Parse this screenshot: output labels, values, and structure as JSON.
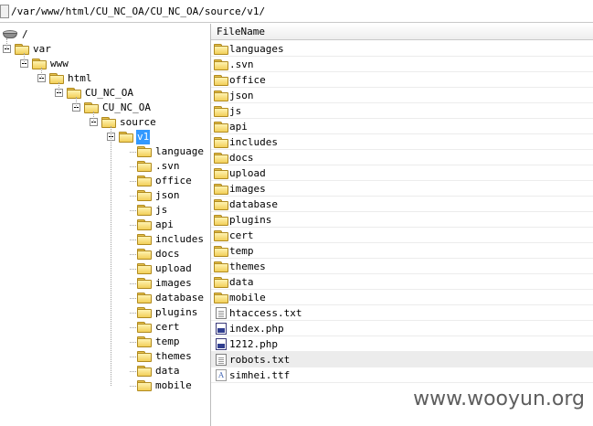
{
  "path_bar": {
    "value": "/var/www/html/CU_NC_OA/CU_NC_OA/source/v1/"
  },
  "tree": {
    "root": "/",
    "ancestors": [
      "var",
      "www",
      "html",
      "CU_NC_OA",
      "CU_NC_OA",
      "source"
    ],
    "selected": "v1",
    "children": [
      "language",
      ".svn",
      "office",
      "json",
      "js",
      "api",
      "includes",
      "docs",
      "upload",
      "images",
      "database",
      "plugins",
      "cert",
      "temp",
      "themes",
      "data",
      "mobile"
    ]
  },
  "file_list": {
    "column_header": "FileName",
    "items": [
      {
        "name": "languages",
        "icon": "folder-icon"
      },
      {
        "name": ".svn",
        "icon": "folder-icon"
      },
      {
        "name": "office",
        "icon": "folder-icon"
      },
      {
        "name": "json",
        "icon": "folder-icon"
      },
      {
        "name": "js",
        "icon": "folder-icon"
      },
      {
        "name": "api",
        "icon": "folder-icon"
      },
      {
        "name": "includes",
        "icon": "folder-icon"
      },
      {
        "name": "docs",
        "icon": "folder-icon"
      },
      {
        "name": "upload",
        "icon": "folder-icon"
      },
      {
        "name": "images",
        "icon": "folder-icon"
      },
      {
        "name": "database",
        "icon": "folder-icon"
      },
      {
        "name": "plugins",
        "icon": "folder-icon"
      },
      {
        "name": "cert",
        "icon": "folder-icon"
      },
      {
        "name": "temp",
        "icon": "folder-icon"
      },
      {
        "name": "themes",
        "icon": "folder-icon"
      },
      {
        "name": "data",
        "icon": "folder-icon"
      },
      {
        "name": "mobile",
        "icon": "folder-icon"
      },
      {
        "name": "htaccess.txt",
        "icon": "text-file-icon"
      },
      {
        "name": "index.php",
        "icon": "php-file-icon"
      },
      {
        "name": "1212.php",
        "icon": "php-file-icon"
      },
      {
        "name": "robots.txt",
        "icon": "text-file-icon",
        "highlighted": true
      },
      {
        "name": "simhei.ttf",
        "icon": "font-file-icon"
      }
    ]
  },
  "watermark": "www.wooyun.org",
  "colors": {
    "selection": "#3399ff",
    "folder": "#f2cf59",
    "row_highlight": "#ececec"
  }
}
